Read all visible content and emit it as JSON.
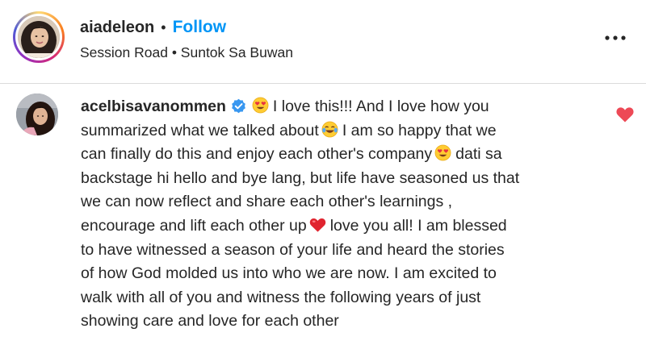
{
  "post_header": {
    "username": "aiadeleon",
    "separator": "•",
    "follow_label": "Follow",
    "location": "Session Road • Suntok Sa Buwan",
    "more_icon": "more-horizontal-icon"
  },
  "comment": {
    "author": "acelbisavanommen",
    "verified": true,
    "lines": [
      "I love this!!! And I love how you",
      "summarized what we talked about",
      "I am so happy that we",
      "can finally do this and enjoy each other's company",
      "dati sa",
      "backstage hi hello and bye lang, but life have seasoned us that",
      "we can now reflect and share each other's learnings ,",
      "encourage and lift each other up",
      "love you all! I am blessed",
      "to have witnessed a season of your life and heard the stories",
      "of how God molded us into who we are now. I am excited to",
      "walk with all of you and witness the following years of just",
      "showing care and love for each other"
    ],
    "emojis": [
      "heart-eyes-emoji",
      "tears-of-joy-emoji",
      "heart-eyes-emoji",
      "red-heart-emoji"
    ],
    "liked": true,
    "like_color": "#ed4956"
  },
  "colors": {
    "link_blue": "#0095f6",
    "text": "#262626",
    "divider": "#dbdbdb",
    "verified_blue": "#3897f0"
  }
}
